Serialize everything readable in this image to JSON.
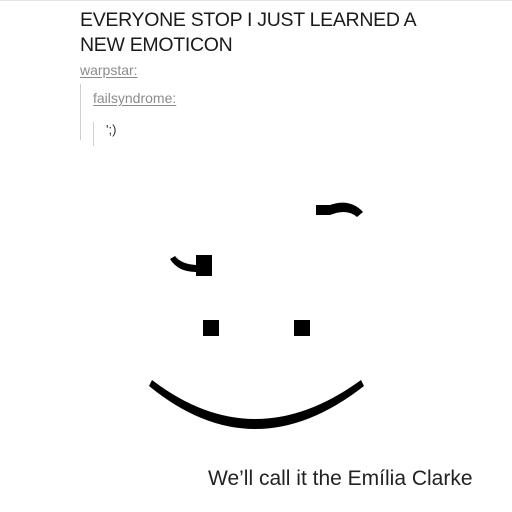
{
  "post": {
    "title_lines": [
      "EVERYONE STOP I JUST LEARNED A",
      "NEW EMOTICON"
    ],
    "reblog_user": "warpstar:",
    "quoted_user": "failsyndrome:",
    "emoticon_text": "';)"
  },
  "caption": "We’ll call it the Emília Clarke"
}
